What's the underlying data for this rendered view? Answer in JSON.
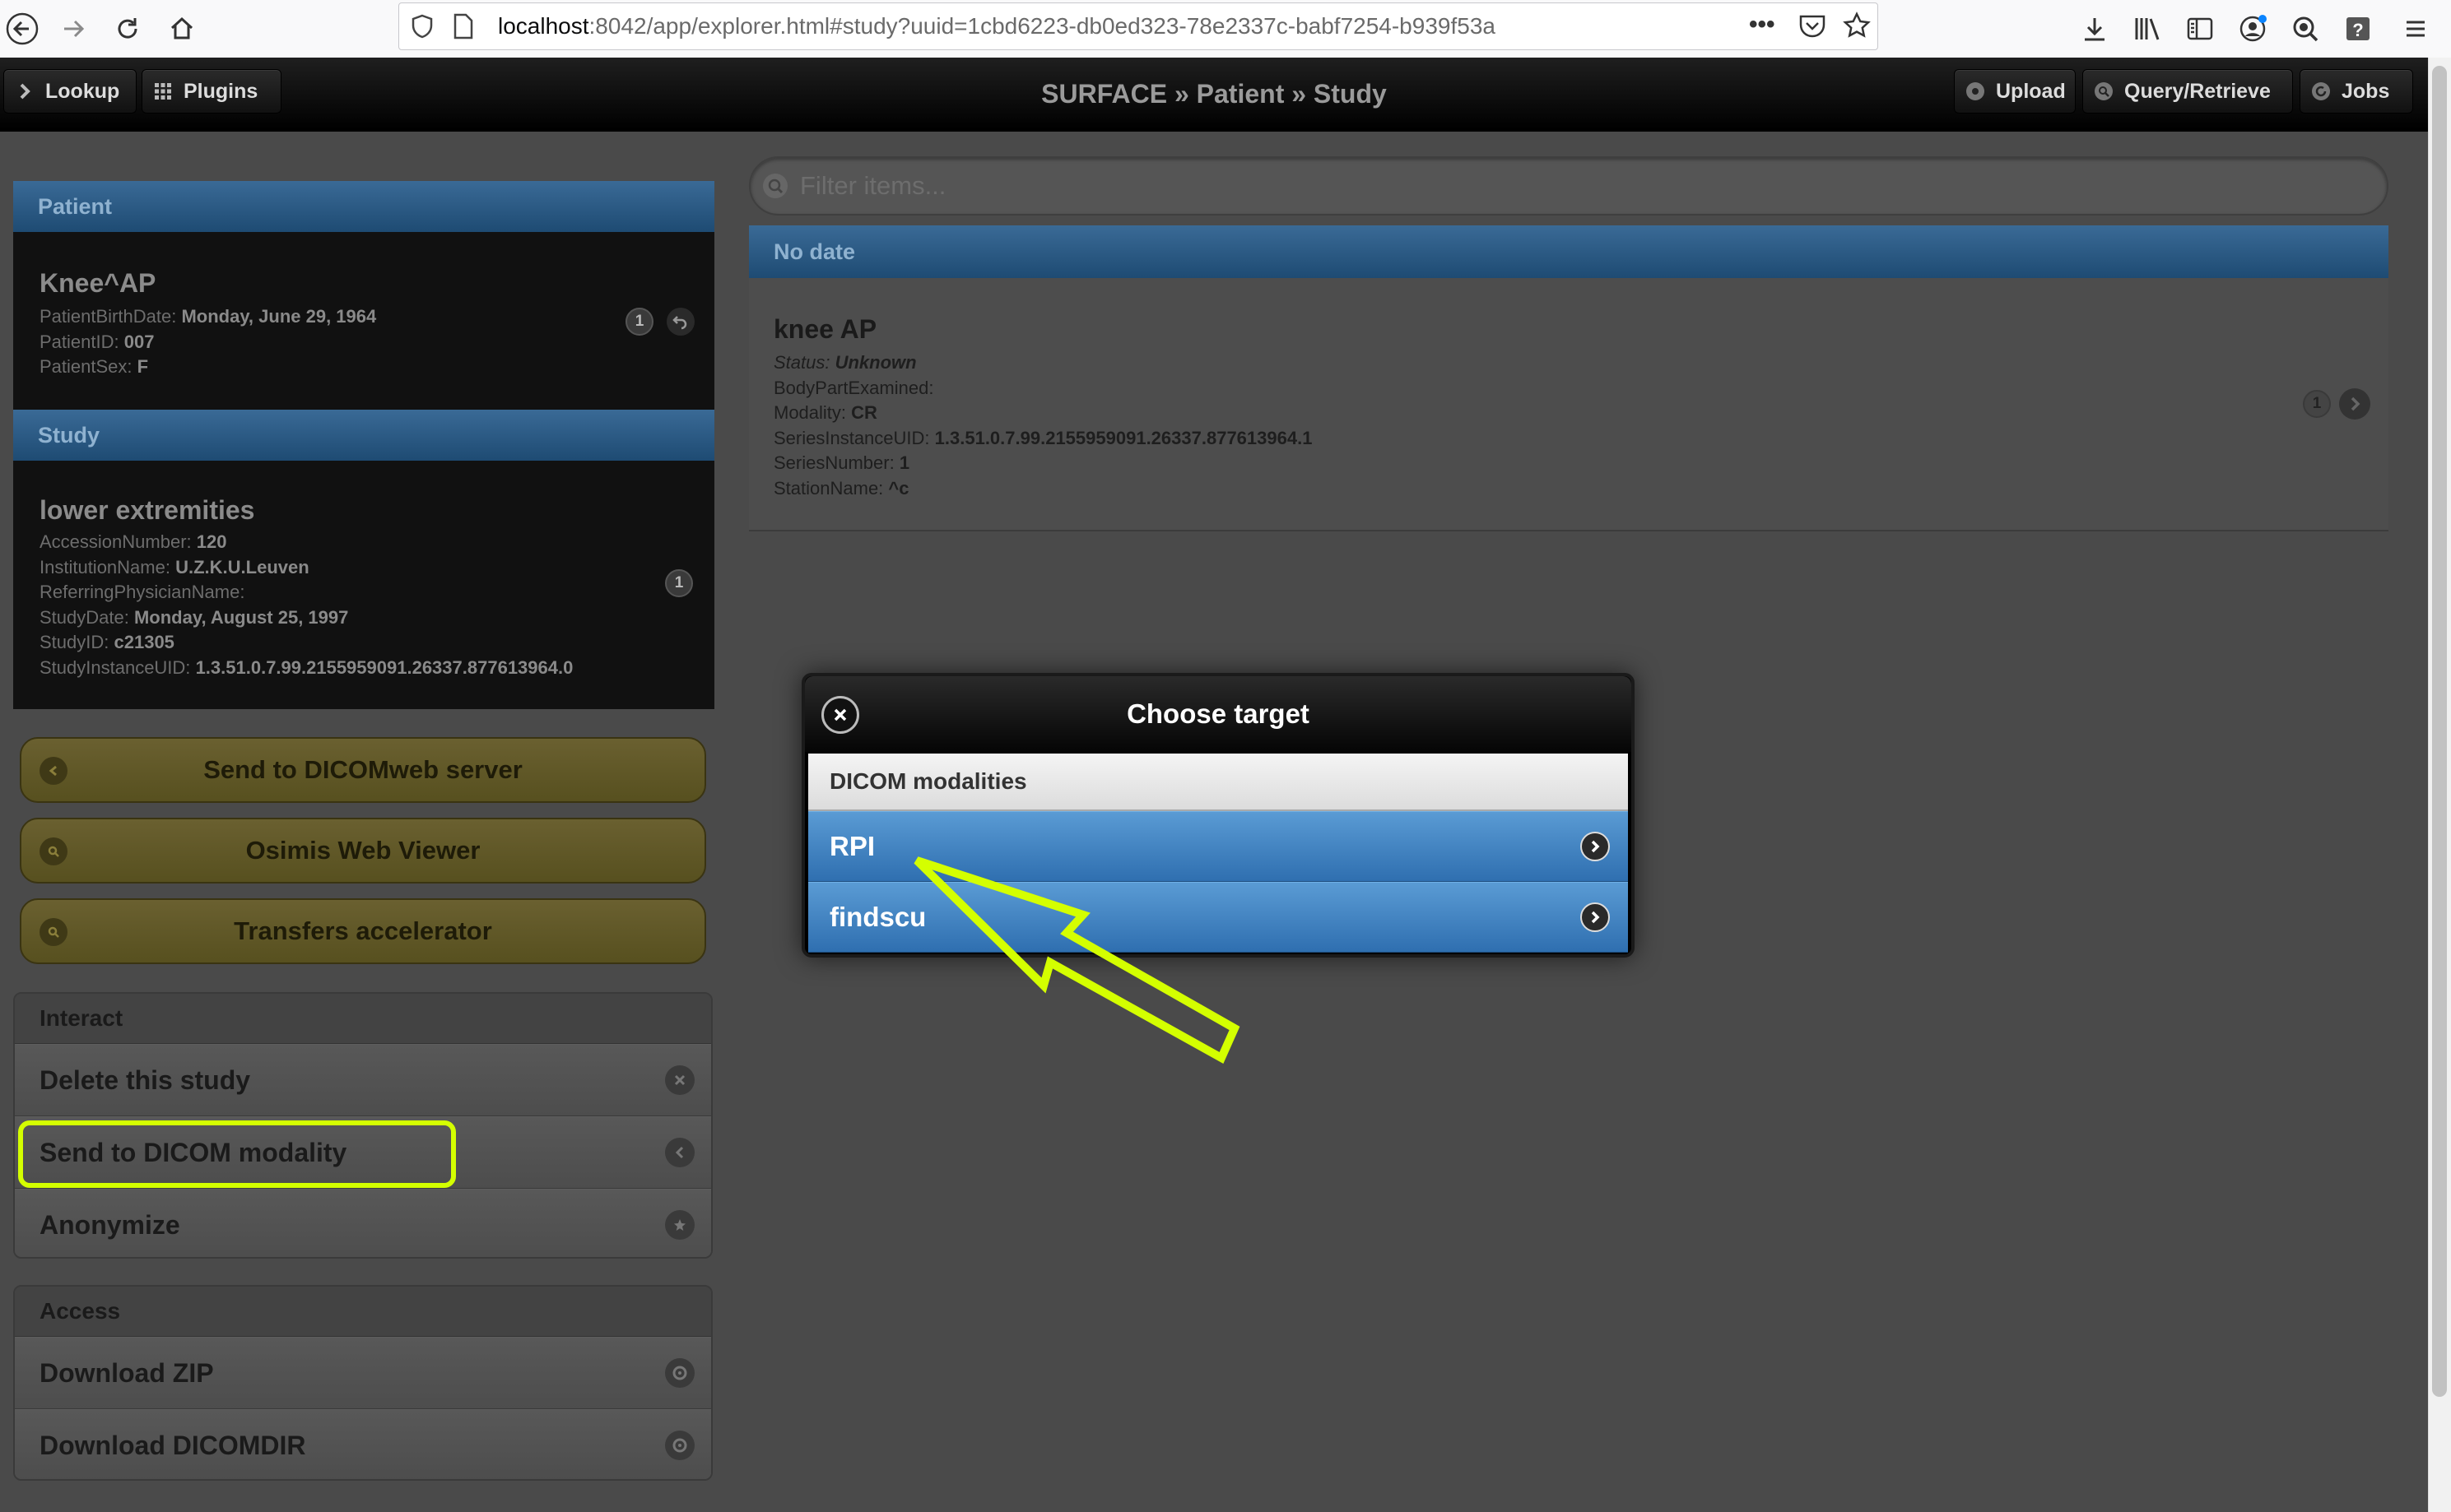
{
  "browser": {
    "url_host": "localhost",
    "url_rest": ":8042/app/explorer.html#study?uuid=1cbd6223-db0ed323-78e2337c-babf7254-b939f53a",
    "more_label": "•••"
  },
  "header": {
    "lookup_label": "Lookup",
    "plugins_label": "Plugins",
    "title": "SURFACE » Patient » Study",
    "upload_label": "Upload",
    "query_label": "Query/Retrieve",
    "jobs_label": "Jobs"
  },
  "patient": {
    "section_label": "Patient",
    "name": "Knee^AP",
    "birth_label": "PatientBirthDate:",
    "birth_value": "Monday, June 29, 1964",
    "id_label": "PatientID:",
    "id_value": "007",
    "sex_label": "PatientSex:",
    "sex_value": "F",
    "count": "1"
  },
  "study": {
    "section_label": "Study",
    "name": "lower extremities",
    "accession_label": "AccessionNumber:",
    "accession_value": "120",
    "institution_label": "InstitutionName:",
    "institution_value": "U.Z.K.U.Leuven",
    "physician_label": "ReferringPhysicianName:",
    "date_label": "StudyDate:",
    "date_value": "Monday, August 25, 1997",
    "studyid_label": "StudyID:",
    "studyid_value": "c21305",
    "uid_label": "StudyInstanceUID:",
    "uid_value": "1.3.51.0.7.99.2155959091.26337.877613964.0",
    "count": "1"
  },
  "plugin_buttons": {
    "dicomweb": "Send to DICOMweb server",
    "osimis": "Osimis Web Viewer",
    "transfers": "Transfers accelerator"
  },
  "interact": {
    "header": "Interact",
    "delete": "Delete this study",
    "send": "Send to DICOM modality",
    "anonymize": "Anonymize"
  },
  "access": {
    "header": "Access",
    "zip": "Download ZIP",
    "dicomdir": "Download DICOMDIR"
  },
  "filter": {
    "placeholder": "Filter items..."
  },
  "series": {
    "group_label": "No date",
    "name": "knee AP",
    "status_label": "Status:",
    "status_value": "Unknown",
    "bodypart_label": "BodyPartExamined:",
    "modality_label": "Modality:",
    "modality_value": "CR",
    "uid_label": "SeriesInstanceUID:",
    "uid_value": "1.3.51.0.7.99.2155959091.26337.877613964.1",
    "number_label": "SeriesNumber:",
    "number_value": "1",
    "station_label": "StationName:",
    "station_value": "^c",
    "count": "1"
  },
  "modal": {
    "title": "Choose target",
    "group_label": "DICOM modalities",
    "options": [
      "RPI",
      "findscu"
    ]
  },
  "colors": {
    "annotation": "#d4ff00",
    "modal_option": "#3f82c4",
    "section_header": "#2a5a84"
  }
}
